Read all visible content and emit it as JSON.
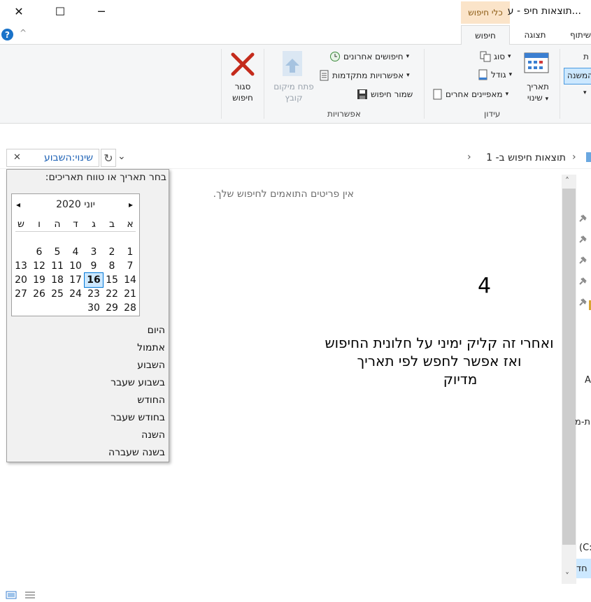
{
  "window": {
    "title": "...תוצאות חיפ - ע",
    "context_tab_label": "כלי חיפוש",
    "minimize_glyph": "─",
    "maximize_glyph": "☐",
    "close_glyph": "✕"
  },
  "tabs": {
    "share": "שיתוף",
    "view": "תצוגה",
    "search": "חיפוש",
    "help_glyph": "?",
    "collapse_glyph": "^"
  },
  "ribbon": {
    "cut_left_label": "ת",
    "changed_label": "המשנה",
    "date_modified": {
      "line1": "תאריך",
      "line2": "שינוי",
      "arrow": "▾"
    },
    "kind_label": "סוג",
    "size_label": "גודל",
    "other_props_label": "מאפיינים אחרים",
    "refine_group_label": "עידון",
    "recent_searches_label": "חיפושים אחרונים",
    "advanced_options_label": "אפשרויות מתקדמות",
    "save_search_label": "שמור חיפוש",
    "open_location": {
      "line1": "פתח מיקום",
      "line2": "קובץ"
    },
    "options_group_label": "אפשרויות",
    "close_search": {
      "line1": "סגור",
      "line2": "חיפוש"
    },
    "dropdown_arrow": "▾"
  },
  "address": {
    "path": "תוצאות חיפוש ב- 1",
    "separator": "›",
    "search_value": "שינוי:השבוע",
    "clear_glyph": "✕",
    "refresh_glyph": "↻",
    "history_glyph": "⌄"
  },
  "date_picker": {
    "prompt": "בחר תאריך או טווח תאריכים:",
    "month_label": "יוני 2020",
    "prev_glyph": "◂",
    "next_glyph": "▸",
    "weekdays": [
      "א",
      "ב",
      "ג",
      "ד",
      "ה",
      "ו",
      "ש"
    ],
    "weeks": [
      [
        "",
        "",
        "",
        "",
        "",
        "",
        ""
      ],
      [
        "1",
        "2",
        "3",
        "4",
        "5",
        "6",
        ""
      ],
      [
        "7",
        "8",
        "9",
        "10",
        "11",
        "12",
        "13"
      ],
      [
        "14",
        "15",
        "16",
        "17",
        "18",
        "19",
        "20"
      ],
      [
        "21",
        "22",
        "23",
        "24",
        "25",
        "26",
        "27"
      ],
      [
        "28",
        "29",
        "30",
        "",
        "",
        "",
        ""
      ]
    ],
    "selected_day": "16",
    "quick_options": [
      "היום",
      "אתמול",
      "השבוע",
      "בשבוע שעבר",
      "החודש",
      "בחודש שעבר",
      "השנה",
      "בשנה שעברה"
    ]
  },
  "content": {
    "empty_message": "אין פריטים התואמים לחיפוש שלך.",
    "step_number": "4",
    "annotation_lines": [
      "ואחרי זה קליק ימיני על חלונית החיפוש",
      "ואז אפשר לחפש לפי תאריך",
      "מדיוק"
    ]
  },
  "sidebar_fragments": {
    "a": "A",
    "t": "ת-מ",
    "c": "(C:",
    "h": "חד"
  },
  "scroll": {
    "up_glyph": "˄",
    "down_glyph": "˅"
  },
  "colors": {
    "accent": "#0078d7",
    "context_tab_bg": "#fbe4c9",
    "close_search_red": "#c42b1c"
  }
}
